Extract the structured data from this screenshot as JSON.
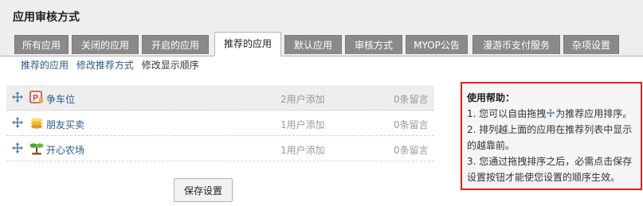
{
  "page": {
    "title": "应用审核方式"
  },
  "tabs": [
    {
      "label": "所有应用",
      "active": false
    },
    {
      "label": "关闭的应用",
      "active": false
    },
    {
      "label": "开启的应用",
      "active": false
    },
    {
      "label": "推荐的应用",
      "active": true
    },
    {
      "label": "默认应用",
      "active": false
    },
    {
      "label": "审核方式",
      "active": false
    },
    {
      "label": "MYOP公告",
      "active": false
    },
    {
      "label": "漫游币支付服务",
      "active": false
    },
    {
      "label": "杂项设置",
      "active": false
    }
  ],
  "subnav": {
    "items": [
      {
        "label": "推荐的应用",
        "link": true
      },
      {
        "label": "修改推荐方式",
        "link": true
      },
      {
        "label": "修改显示顺序",
        "link": false
      }
    ]
  },
  "apps": [
    {
      "name": "争车位",
      "adds": "2用户添加",
      "comments": "0条留言",
      "icon": "parking-icon"
    },
    {
      "name": "朋友买卖",
      "adds": "1用户添加",
      "comments": "0条留言",
      "icon": "coins-icon"
    },
    {
      "name": "开心农场",
      "adds": "1用户添加",
      "comments": "0条留言",
      "icon": "sprout-icon"
    }
  ],
  "actions": {
    "save_label": "保存设置"
  },
  "help": {
    "title": "使用帮助：",
    "item1_before": "1. 您可以自由拖拽",
    "item1_after": "为推荐应用排序。",
    "item2": "2. 排列越上面的应用在推荐列表中显示的越靠前。",
    "item3": "3. 您通过拖拽排序之后，必需点击保存设置按钮才能使您设置的顺序生效。"
  },
  "colors": {
    "link": "#2a5a8a",
    "tab_bg": "#8a8a8a",
    "help_border": "#e02020"
  }
}
